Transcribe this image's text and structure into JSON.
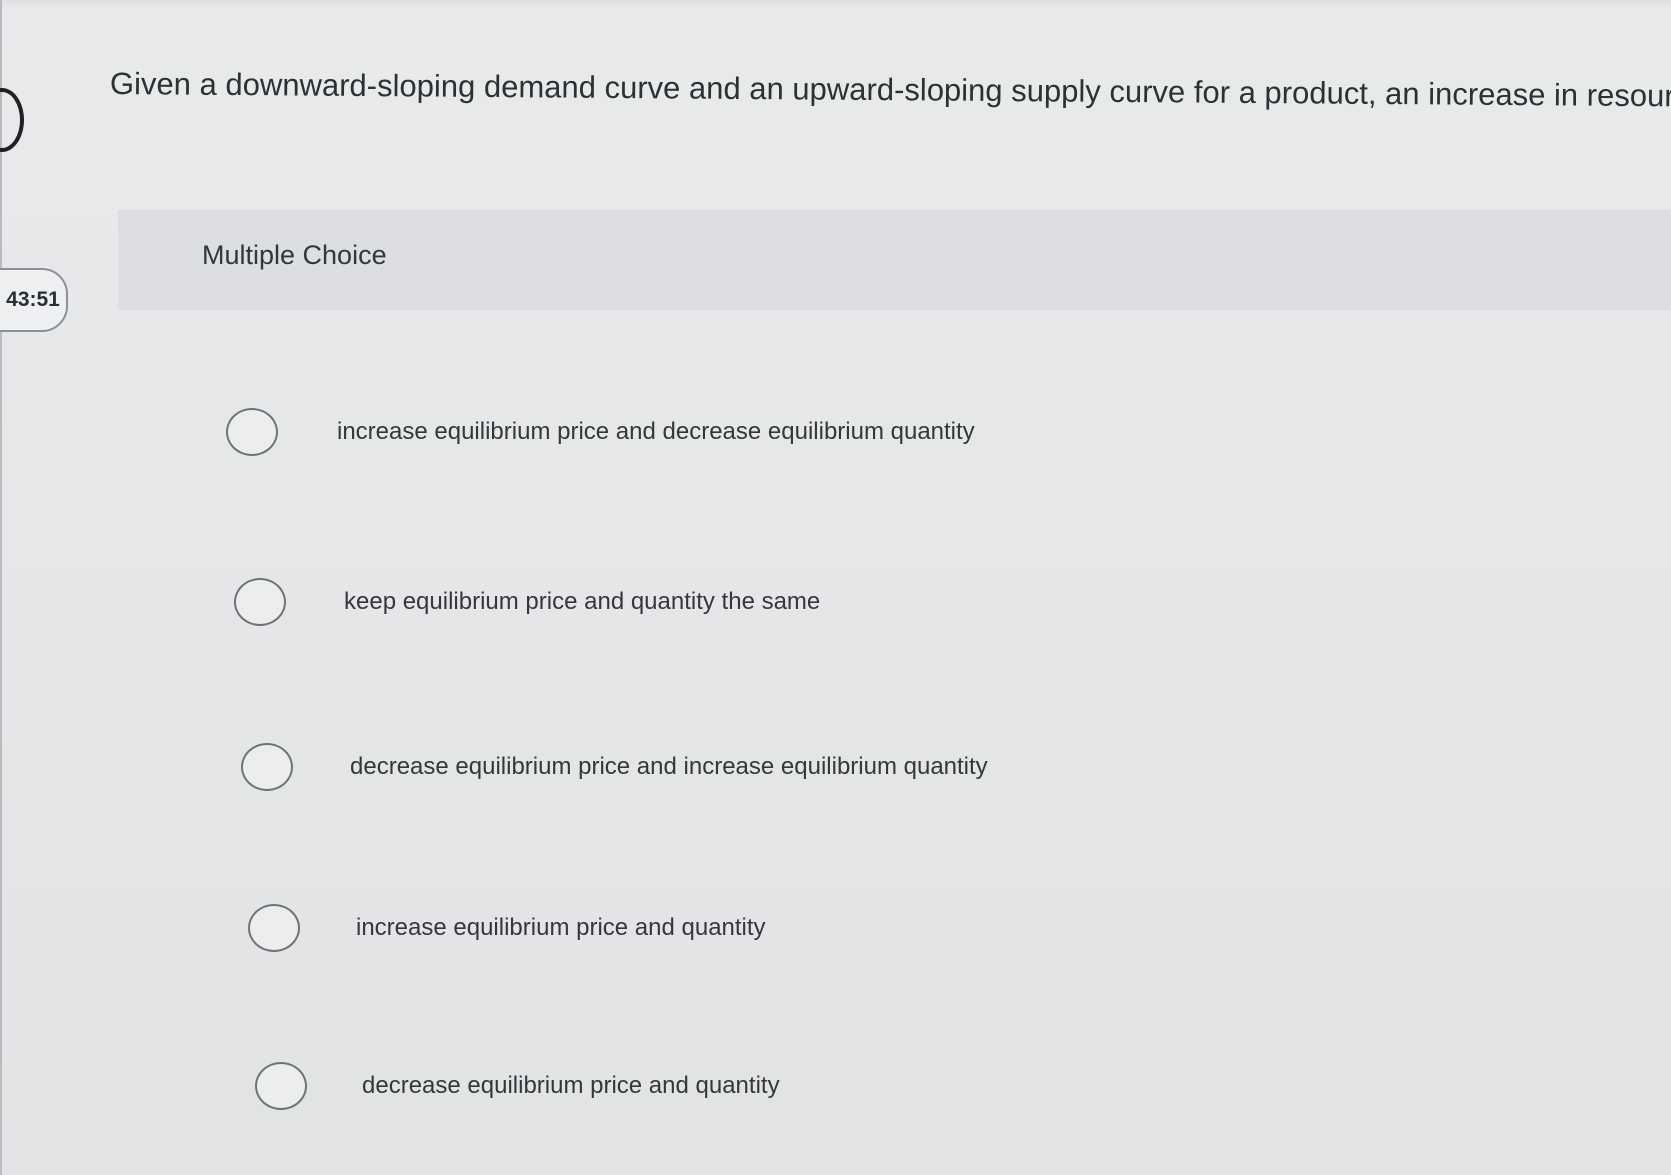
{
  "question": {
    "text": "Given a downward-sloping demand curve and an upward-sloping supply curve for a product, an increase in resource"
  },
  "timer": {
    "value": "43:51"
  },
  "answer_panel": {
    "type_label": "Multiple Choice",
    "options": [
      {
        "label": "increase equilibrium price and decrease equilibrium quantity",
        "selected": false
      },
      {
        "label": "keep equilibrium price and quantity the same",
        "selected": false
      },
      {
        "label": "decrease equilibrium price and increase equilibrium quantity",
        "selected": false
      },
      {
        "label": "increase equilibrium price and quantity",
        "selected": false
      },
      {
        "label": "decrease equilibrium price and quantity",
        "selected": false
      }
    ]
  },
  "icons": {
    "question_marker": "question-number-icon",
    "radio": "radio-button-icon"
  },
  "colors": {
    "background": "#e6e7e8",
    "panel_header": "#dcdee1",
    "text": "#2f3236",
    "radio_border": "#6f7378"
  }
}
